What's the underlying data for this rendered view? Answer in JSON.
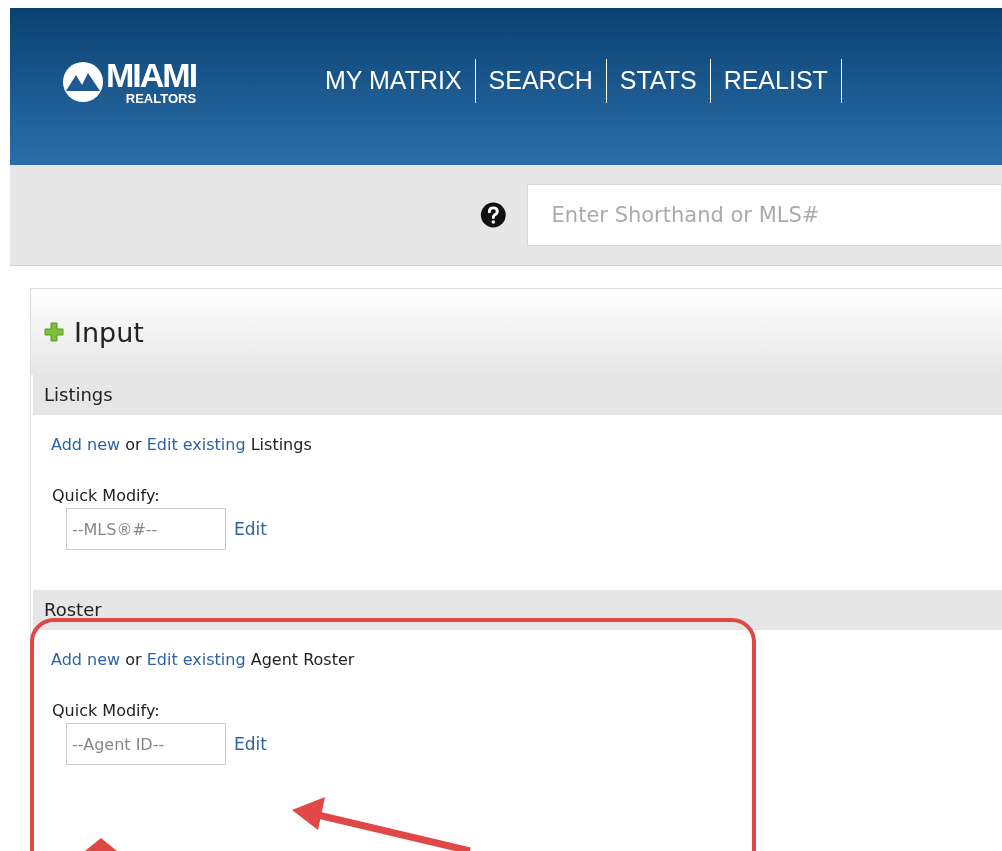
{
  "header": {
    "logo": {
      "title": "MIAMI",
      "subtitle": "REALTORS"
    },
    "nav": [
      {
        "label": "MY MATRIX"
      },
      {
        "label": "SEARCH"
      },
      {
        "label": "STATS"
      },
      {
        "label": "REALIST"
      }
    ]
  },
  "search": {
    "placeholder": "Enter Shorthand or MLS#"
  },
  "panel": {
    "title": "Input",
    "sections": [
      {
        "title": "Listings",
        "add_link": "Add new",
        "joiner": "or",
        "edit_link": "Edit existing",
        "object": "Listings",
        "quick_label": "Quick Modify:",
        "placeholder": "--MLS®#--",
        "action": "Edit"
      },
      {
        "title": "Roster",
        "add_link": "Add new",
        "joiner": "or",
        "edit_link": "Edit existing",
        "object": "Agent Roster",
        "quick_label": "Quick Modify:",
        "placeholder": "--Agent ID--",
        "action": "Edit"
      }
    ]
  }
}
